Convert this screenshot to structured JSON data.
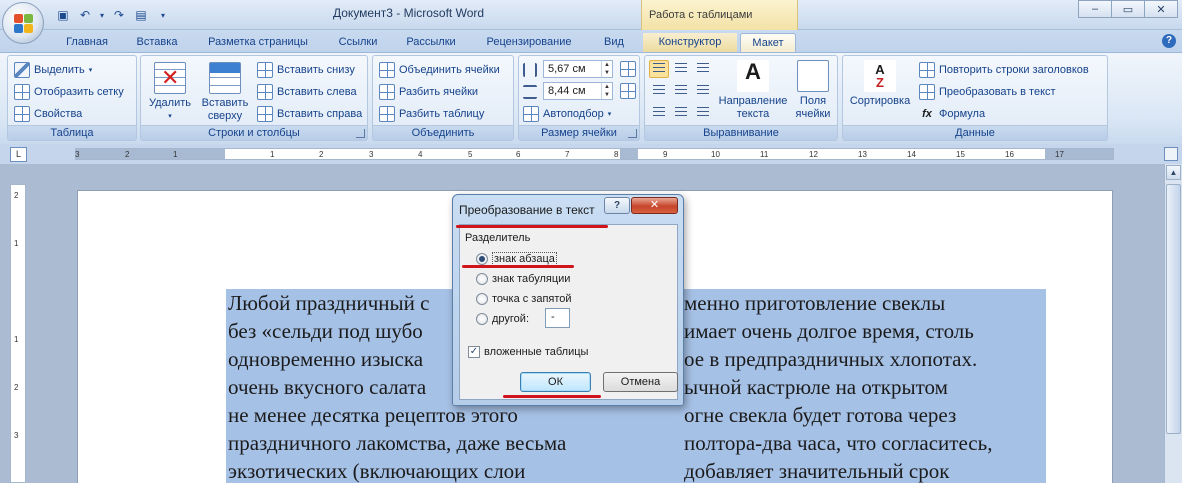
{
  "window": {
    "title": "Документ3 - Microsoft Word",
    "context_title": "Работа с таблицами",
    "controls": [
      "–",
      "▭",
      "✕"
    ]
  },
  "tabs": [
    {
      "label": "Главная"
    },
    {
      "label": "Вставка"
    },
    {
      "label": "Разметка страницы"
    },
    {
      "label": "Ссылки"
    },
    {
      "label": "Рассылки"
    },
    {
      "label": "Рецензирование"
    },
    {
      "label": "Вид"
    },
    {
      "label": "Конструктор"
    },
    {
      "label": "Макет"
    }
  ],
  "ribbon": {
    "table_group": {
      "label": "Таблица",
      "select": "Выделить",
      "show_grid": "Отобразить сетку",
      "properties": "Свойства"
    },
    "rows_cols_group": {
      "label": "Строки и столбцы",
      "delete": "Удалить",
      "insert_above_1": "Вставить",
      "insert_above_2": "сверху",
      "insert_below": "Вставить снизу",
      "insert_left": "Вставить слева",
      "insert_right": "Вставить справа"
    },
    "merge_group": {
      "label": "Объединить",
      "merge_cells": "Объединить ячейки",
      "split_cells": "Разбить ячейки",
      "split_table": "Разбить таблицу"
    },
    "cell_size_group": {
      "label": "Размер ячейки",
      "height": "5,67 см",
      "width": "8,44 см",
      "autofit": "Автоподбор"
    },
    "alignment_group": {
      "label": "Выравнивание",
      "text_direction_1": "Направление",
      "text_direction_2": "текста",
      "cell_margins_1": "Поля",
      "cell_margins_2": "ячейки"
    },
    "data_group": {
      "label": "Данные",
      "sort": "Сортировка",
      "repeat_header": "Повторить строки заголовков",
      "convert_to_text": "Преобразовать в текст",
      "formula": "Формула"
    }
  },
  "ruler": {
    "ticks": [
      "3",
      "2",
      "1",
      "1",
      "2",
      "3",
      "4",
      "5",
      "6",
      "7",
      "8",
      "9",
      "10",
      "11",
      "12",
      "13",
      "14",
      "15",
      "16",
      "17"
    ]
  },
  "vruler": {
    "ticks": [
      "2",
      "1",
      "1",
      "2",
      "3"
    ]
  },
  "document": {
    "left_col": [
      "Любой праздничный с",
      "без «сельди под шубо",
      "одновременно изыска",
      "очень вкусного салата",
      "не менее десятка рецептов этого",
      "праздничного лакомства, даже весьма",
      "экзотических (включающих слои"
    ],
    "right_col": [
      "менно приготовление свеклы",
      "имает очень долгое время, столь",
      "ое в предпраздничных хлопотах.",
      "ычной кастрюле на открытом",
      "огне свекла будет готова через",
      "полтора-два часа, что согласитесь,",
      "добавляет значительный срок"
    ]
  },
  "dialog": {
    "title": "Преобразование в текст",
    "help_glyph": "?",
    "close_glyph": "✕",
    "separator_label": "Разделитель",
    "options": [
      {
        "label": "знак абзаца",
        "selected": true
      },
      {
        "label": "знак табуляции",
        "selected": false
      },
      {
        "label": "точка с запятой",
        "selected": false
      },
      {
        "label": "другой:",
        "selected": false
      }
    ],
    "other_value": "-",
    "nested_tables_label": "вложенные таблицы",
    "nested_tables_checked": true,
    "ok_label": "ОК",
    "cancel_label": "Отмена"
  },
  "colors": {
    "annotation_red": "#d0141c",
    "selection_blue": "#a6c1e6",
    "ribbon_text": "#15428b"
  }
}
